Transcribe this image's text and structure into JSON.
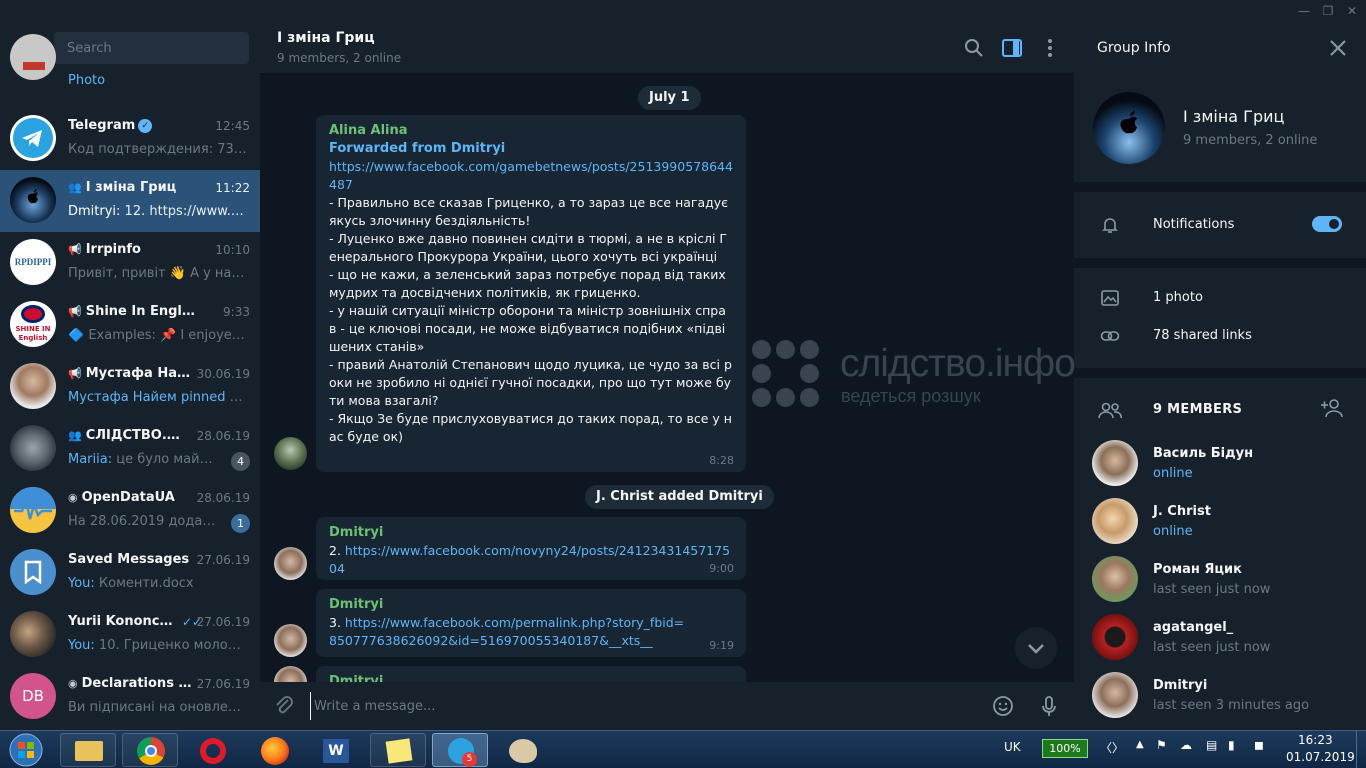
{
  "sidebar": {
    "search_placeholder": "Search",
    "partial_item_preview": "Photo",
    "chats": [
      {
        "name": "Telegram",
        "time": "12:45",
        "preview": "Код подтверждения: 73414...",
        "verified": true
      },
      {
        "name": "I зміна Гриц",
        "time": "11:22",
        "preview_sender": "Dmitryi:",
        "preview": " 12. https://www.face...",
        "icon": "group-icon"
      },
      {
        "name": "Irrpinfo",
        "time": "10:10",
        "preview": "Привіт,  привіт 👋 А у нас х...",
        "icon": "channel-icon",
        "avatar_text": "RPDIPPI"
      },
      {
        "name": "Shine In English",
        "time": "9:33",
        "preview": "🔷 Examples: 📌 I enjoyed ...",
        "icon": "channel-icon",
        "avatar_text": "SHINE IN English"
      },
      {
        "name": "Мустафа Найем",
        "time": "30.06.19",
        "preview_sender": "Мустафа Найем pinned «На...",
        "preview": "",
        "icon": "channel-icon"
      },
      {
        "name": "СЛІДСТВО.НО...",
        "time": "28.06.19",
        "preview_sender": "Mariia:",
        "preview": " це було майже д...",
        "icon": "group-icon",
        "badge": "4",
        "badge_muted": true
      },
      {
        "name": "OpenDataUA",
        "time": "28.06.19",
        "preview": "На 28.06.2019 додано 2 с...",
        "icon": "bot-icon",
        "badge": "1",
        "badge_muted": false
      },
      {
        "name": "Saved Messages",
        "time": "27.06.19",
        "preview_sender": "You:",
        "preview": " Коменти.docx"
      },
      {
        "name": "Yurii Kononchuk",
        "time": "27.06.19",
        "preview_sender": "You:",
        "preview": " 10. Гриценко молодец...",
        "read": true
      },
      {
        "name": "Declarations Bot",
        "time": "27.06.19",
        "preview": "Ви підписані на оновлення ...",
        "icon": "bot-icon",
        "avatar_text": "DB"
      }
    ]
  },
  "chat": {
    "title": "I зміна Гриц",
    "subtitle": "9 members, 2 online",
    "date_label": "July 1",
    "service_label": "J. Christ added Dmitryi",
    "composer_placeholder": "Write a message...",
    "messages": [
      {
        "sender": "Alina Alina",
        "forwarded": "Forwarded from Dmitryi",
        "link": "https://www.facebook.com/gamebetnews/posts/2513990578644487",
        "text": "\n- Правильно все сказав Гриценко, а то зараз це все нагадує якусь злочинну бездіяльність!\n- Луценко вже давно повинен сидіти в тюрмі, а не в кріслі Генерального Прокурора України, цього хочуть всі українці\n- що не кажи, а зеленський зараз потребує порад від таких мудрих та досвідчених політиків, як гриценко.\n- у нашій ситуації міністр оборони та міністр зовнішніх справ - це ключові посади, не може відбуватися подібних «підвішених станів»\n- правий Анатолій Степанович щодо луцика, це чудо за всі роки не зробило ні однієї гучної посадки, про що тут може бути мова взагалі?\n- Якщо Зе буде прислуховуватися до таких порад, то все у нас буде ок)",
        "time": "8:28"
      },
      {
        "sender": "Dmitryi",
        "prefix": "2. ",
        "link": "https://www.facebook.com/novyny24/posts/2412343145717504",
        "time": "9:00"
      },
      {
        "sender": "Dmitryi",
        "prefix": "3. ",
        "link": "https://www.facebook.com/permalink.php?story_fbid=850777638626092&id=516970055340187&__xts__",
        "time": "9:19"
      },
      {
        "sender": "Dmitryi"
      }
    ]
  },
  "watermark": {
    "title": "слідство.інфо",
    "subtitle": "ведеться розшук"
  },
  "group_info": {
    "title": "Group Info",
    "name": "I зміна Гриц",
    "subtitle": "9 members, 2 online",
    "notifications_label": "Notifications",
    "notifications_on": true,
    "photos_label": "1 photo",
    "links_label": "78 shared links",
    "members_title": "9 MEMBERS",
    "members": [
      {
        "name": "Василь Бідун",
        "status": "online",
        "online": true
      },
      {
        "name": "J. Christ",
        "status": "online",
        "online": true
      },
      {
        "name": "Роман Яцик",
        "status": "last seen just now",
        "online": false
      },
      {
        "name": "agatangel_",
        "status": "last seen just now",
        "online": false
      },
      {
        "name": "Dmitryi",
        "status": "last seen 3 minutes ago",
        "online": false
      }
    ]
  },
  "taskbar": {
    "language": "UK",
    "battery": "100%",
    "time": "16:23",
    "date": "01.07.2019",
    "telegram_badge": "5"
  },
  "colors": {
    "accent": "#5eb5f7",
    "sender_green": "#6ec174",
    "active_chat": "#2b5278",
    "panel": "#17212b",
    "background": "#0e1621"
  }
}
